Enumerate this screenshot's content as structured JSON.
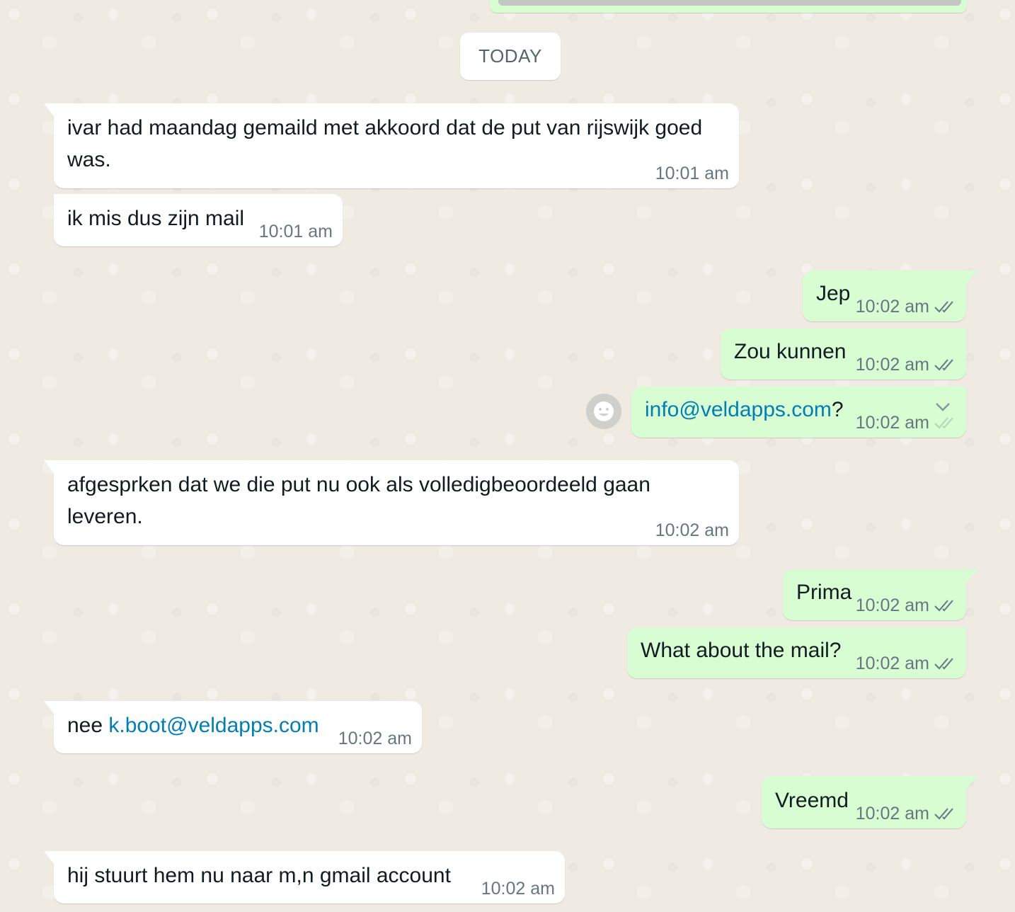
{
  "date_separator": "TODAY",
  "messages": [
    {
      "direction": "in",
      "text": "ivar had maandag gemaild met akkoord dat de put van rijswijk goed was.",
      "time": "10:01 am"
    },
    {
      "direction": "in",
      "text": "ik mis dus zijn mail",
      "time": "10:01 am"
    },
    {
      "direction": "out",
      "text": "Jep",
      "time": "10:02 am",
      "status": "read"
    },
    {
      "direction": "out",
      "text": "Zou kunnen",
      "time": "10:02 am",
      "status": "read"
    },
    {
      "direction": "out",
      "link": "info@veldapps.com",
      "text_after": "?",
      "time": "10:02 am",
      "status": "read"
    },
    {
      "direction": "in",
      "text": "afgesprken dat we die put nu ook als volledigbeoordeeld gaan leveren.",
      "time": "10:02 am"
    },
    {
      "direction": "out",
      "text": "Prima",
      "time": "10:02 am",
      "status": "read"
    },
    {
      "direction": "out",
      "text": "What about the mail?",
      "time": "10:02 am",
      "status": "read"
    },
    {
      "direction": "in",
      "text_before": "nee ",
      "link": "k.boot@veldapps.com",
      "time": "10:02 am"
    },
    {
      "direction": "out",
      "text": "Vreemd",
      "time": "10:02 am",
      "status": "read"
    },
    {
      "direction": "in",
      "text": "hij stuurt hem nu naar m,n gmail account",
      "time": "10:02 am"
    }
  ],
  "icons": {
    "read_receipt": "double-check-icon",
    "message_menu": "chevron-down-icon",
    "reaction": "smiley-icon"
  },
  "colors": {
    "wallpaper": "#efeae2",
    "incoming_bubble": "#ffffff",
    "outgoing_bubble": "#d9fdd3",
    "link": "#027eb5",
    "meta_text": "#667781"
  }
}
